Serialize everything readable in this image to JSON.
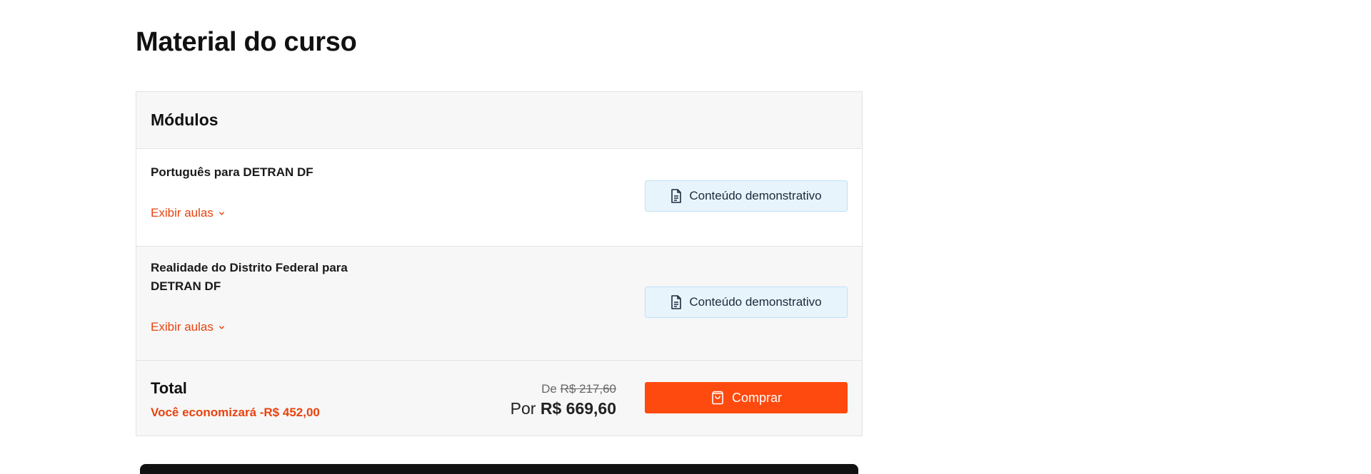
{
  "page": {
    "title": "Material do curso"
  },
  "modules_panel": {
    "header_label": "Módulos",
    "modules": [
      {
        "title": "Português para DETRAN DF",
        "expand_label": "Exibir aulas",
        "demo_label": "Conteúdo demonstrativo"
      },
      {
        "title": "Realidade do Distrito Federal para DETRAN DF",
        "expand_label": "Exibir aulas",
        "demo_label": "Conteúdo demonstrativo"
      }
    ]
  },
  "total": {
    "label": "Total",
    "savings": "Você economizará -R$ 452,00",
    "old_price_prefix": "De",
    "old_price": "R$ 217,60",
    "new_price_prefix": "Por",
    "new_price": "R$ 669,60",
    "buy_label": "Comprar"
  },
  "icons": {
    "chevron": "chevron-down-icon",
    "document": "document-icon",
    "bag": "shopping-bag-icon"
  },
  "colors": {
    "accent": "#e8430f",
    "buy_button": "#ff4a0f",
    "demo_bg": "#e8f4fc",
    "panel_bg": "#f7f7f7"
  }
}
